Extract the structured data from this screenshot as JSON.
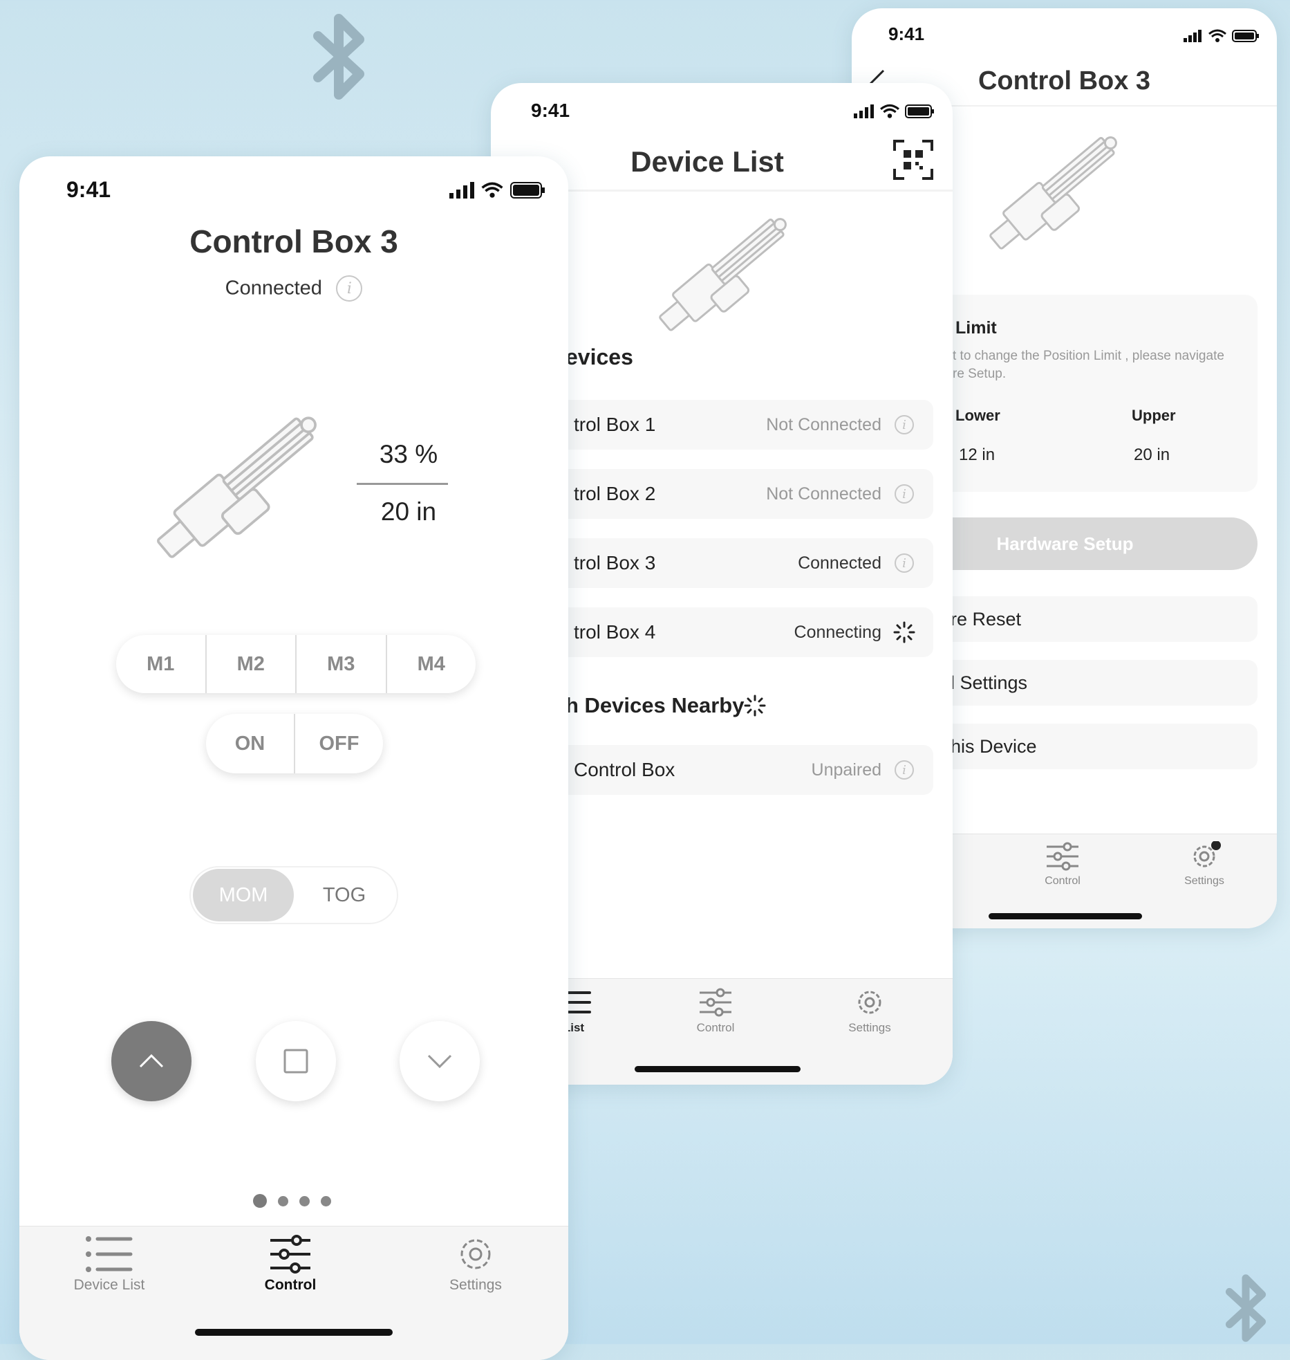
{
  "colors": {
    "accent_gray": "#7b7b7b",
    "text": "#222222",
    "muted": "#9a9a9a"
  },
  "control_screen": {
    "status_time": "9:41",
    "title": "Control Box 3",
    "connection_status": "Connected",
    "percent": "33 %",
    "position": "20 in",
    "memory_buttons": [
      "M1",
      "M2",
      "M3",
      "M4"
    ],
    "power_buttons": [
      "ON",
      "OFF"
    ],
    "mode_buttons": [
      "MOM",
      "TOG"
    ],
    "tabs": {
      "device_list": "Device List",
      "control": "Control",
      "settings": "Settings"
    }
  },
  "device_list_screen": {
    "status_time": "9:41",
    "title": "Device List",
    "section_paired": "evices",
    "devices": [
      {
        "name": "trol Box 1",
        "status": "Not Connected"
      },
      {
        "name": "trol Box 2",
        "status": "Not Connected"
      },
      {
        "name": "trol Box 3",
        "status": "Connected"
      },
      {
        "name": "trol Box 4",
        "status": "Connecting"
      }
    ],
    "section_nearby": "h Devices Nearby",
    "nearby": [
      {
        "name": "Control Box",
        "status": "Unpaired"
      }
    ],
    "tabs": {
      "device_list": "List",
      "control": "Control",
      "settings": "Settings"
    }
  },
  "settings_screen": {
    "status_time": "9:41",
    "title": "Control Box 3",
    "limit_title": "Limit",
    "limit_desc_1": "t to change the Position Limit , please navigate",
    "limit_desc_2": "re Setup.",
    "lower_label": "Lower",
    "lower_value": "12 in",
    "upper_label": "Upper",
    "upper_value": "20 in",
    "hardware_button": "Hardware Setup",
    "rows": [
      "re Reset",
      "l Settings",
      "his Device"
    ],
    "tabs": {
      "control": "Control",
      "settings": "Settings"
    }
  }
}
